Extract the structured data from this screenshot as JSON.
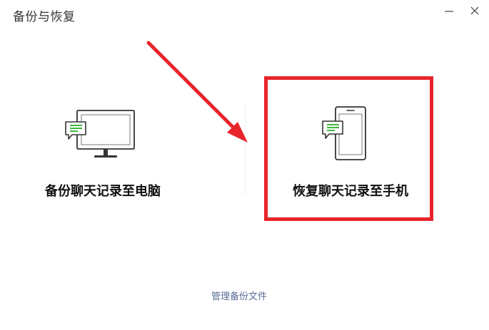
{
  "window": {
    "title": "备份与恢复",
    "minimize_icon": "minimize-icon",
    "close_icon": "close-icon"
  },
  "options": {
    "backup": {
      "label": "备份聊天记录至电脑",
      "icon": "computer-chat-icon"
    },
    "restore": {
      "label": "恢复聊天记录至手机",
      "icon": "phone-chat-icon"
    }
  },
  "footer": {
    "manage_link": "管理备份文件"
  },
  "colors": {
    "annotation_red": "#e8242b",
    "chat_bubble_green": "#3fb83f",
    "link_blue": "#576b95",
    "icon_stroke": "#333333"
  }
}
